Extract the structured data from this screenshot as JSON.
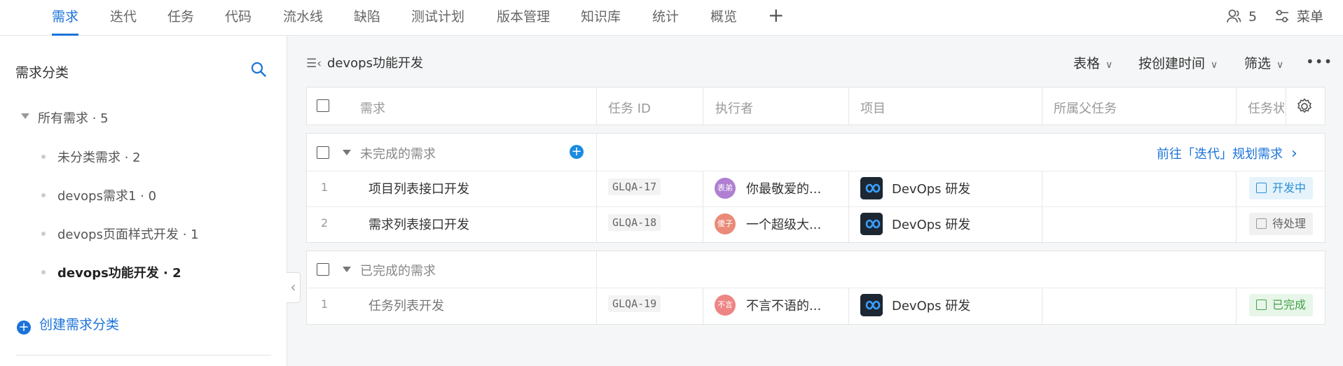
{
  "nav": {
    "tabs": [
      "需求",
      "迭代",
      "任务",
      "代码",
      "流水线",
      "缺陷",
      "测试计划",
      "版本管理",
      "知识库",
      "统计",
      "概览"
    ],
    "active_tab": "需求",
    "add": "+",
    "member_count": "5",
    "menu_label": "菜单"
  },
  "sidebar": {
    "title": "需求分类",
    "root": "所有需求 · 5",
    "items": [
      {
        "label": "未分类需求 · 2",
        "active": false
      },
      {
        "label": "devops需求1 · 0",
        "active": false
      },
      {
        "label": "devops页面样式开发 · 1",
        "active": false
      },
      {
        "label": "devops功能开发 · 2",
        "active": true
      }
    ],
    "create_label": "创建需求分类"
  },
  "header": {
    "breadcrumb": "devops功能开发",
    "view_label": "表格",
    "sort_label": "按创建时间",
    "filter_label": "筛选",
    "more": "•••"
  },
  "table": {
    "columns": [
      "需求",
      "任务 ID",
      "执行者",
      "项目",
      "所属父任务",
      "任务状"
    ],
    "groups": [
      {
        "label": "未完成的需求",
        "action": "前往「迭代」规划需求",
        "rows": [
          {
            "num": "1",
            "title": "项目列表接口开发",
            "task_id": "GLQA-17",
            "avatar_text": "表弟",
            "avatar_color": "#b07fd1",
            "executor": "你最敬爱的...",
            "project": "DevOps 研发",
            "parent": "",
            "status": "开发中",
            "status_kind": "dev"
          },
          {
            "num": "2",
            "title": "需求列表接口开发",
            "task_id": "GLQA-18",
            "avatar_text": "傻子",
            "avatar_color": "#ea8a78",
            "executor": "一个超级大...",
            "project": "DevOps 研发",
            "parent": "",
            "status": "待处理",
            "status_kind": "todo"
          }
        ]
      },
      {
        "label": "已完成的需求",
        "action": "",
        "rows": [
          {
            "num": "1",
            "title": "任务列表开发",
            "task_id": "GLQA-19",
            "avatar_text": "不言",
            "avatar_color": "#ee8585",
            "executor": "不言不语的...",
            "project": "DevOps 研发",
            "parent": "",
            "status": "已完成",
            "status_kind": "done"
          }
        ]
      }
    ]
  },
  "colors": {
    "accent": "#1b73d8",
    "dev": "#2a8fd6",
    "done": "#43a047"
  }
}
